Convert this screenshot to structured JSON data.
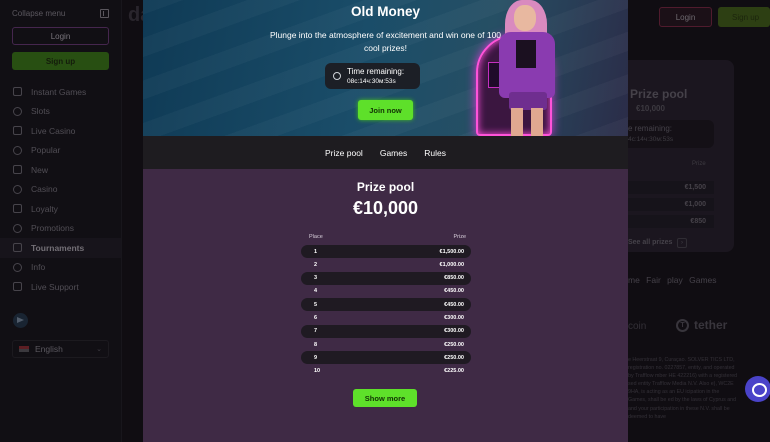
{
  "sidebar": {
    "collapse_label": "Collapse menu",
    "login_label": "Login",
    "signup_label": "Sign up",
    "items": [
      {
        "label": "Instant Games",
        "icon": "rocket-icon"
      },
      {
        "label": "Slots",
        "icon": "slots-icon"
      },
      {
        "label": "Live Casino",
        "icon": "chip-icon"
      },
      {
        "label": "Popular",
        "icon": "star-icon"
      },
      {
        "label": "New",
        "icon": "sparkle-icon"
      },
      {
        "label": "Casino",
        "icon": "coins-icon"
      },
      {
        "label": "Loyalty",
        "icon": "crown-icon"
      },
      {
        "label": "Promotions",
        "icon": "gift-icon"
      },
      {
        "label": "Tournaments",
        "icon": "trophy-icon",
        "active": true
      },
      {
        "label": "Info",
        "icon": "info-icon"
      },
      {
        "label": "Live Support",
        "icon": "chat-icon"
      }
    ],
    "language": "English"
  },
  "header": {
    "logo_text": "da",
    "login_label": "Login",
    "signup_label": "Sign up"
  },
  "background_page": {
    "prize_pool_title": "Prize pool",
    "prize_pool_amount": "€10,000",
    "time_label": "e remaining:",
    "time_value": "4c:14ч:30м:53s",
    "prize_header": "Prize",
    "rows": [
      "€1,500",
      "€1,000",
      "€850"
    ],
    "see_all": "See all prizes",
    "tabs": "me  Fair play  Games",
    "coin_text": "coin",
    "tether_text": "tether",
    "legal_text": "e Heerstraat 9, Curaçao. SOLVER TICS LTD, registration no. 0227857, entity, and operated by Trafflow mber HE 422216) with a registered sed entity Trafflow Media N.V. Also e), WC2E 9HA, is acting as an EU icipation in the Games, shall be ed by the laws of Cyprus and and your participation in these N.V. shall be deemed to have"
  },
  "modal": {
    "title": "Old Money",
    "subtitle": "Plunge into the atmosphere of excitement and win one of 100 cool prizes!",
    "timer_label": "Time remaining:",
    "timer_value": "08c:14ч:30м:53s",
    "join_label": "Join now",
    "tabs": [
      "Prize pool",
      "Games",
      "Rules"
    ],
    "prize_pool_title": "Prize pool",
    "prize_pool_amount": "€10,000",
    "table_headers": {
      "place": "Place",
      "prize": "Prize"
    },
    "rows": [
      {
        "place": "1",
        "prize": "€1,500.00"
      },
      {
        "place": "2",
        "prize": "€1,000.00"
      },
      {
        "place": "3",
        "prize": "€850.00"
      },
      {
        "place": "4",
        "prize": "€450.00"
      },
      {
        "place": "5",
        "prize": "€450.00"
      },
      {
        "place": "6",
        "prize": "€300.00"
      },
      {
        "place": "7",
        "prize": "€300.00"
      },
      {
        "place": "8",
        "prize": "€250.00"
      },
      {
        "place": "9",
        "prize": "€250.00"
      },
      {
        "place": "10",
        "prize": "€225.00"
      }
    ],
    "show_more_label": "Show more"
  },
  "colors": {
    "accent_green": "#5ee02a",
    "modal_content_bg": "#3f2a45",
    "row_dark": "#1f1a22",
    "chat_button": "#4a43c9"
  }
}
